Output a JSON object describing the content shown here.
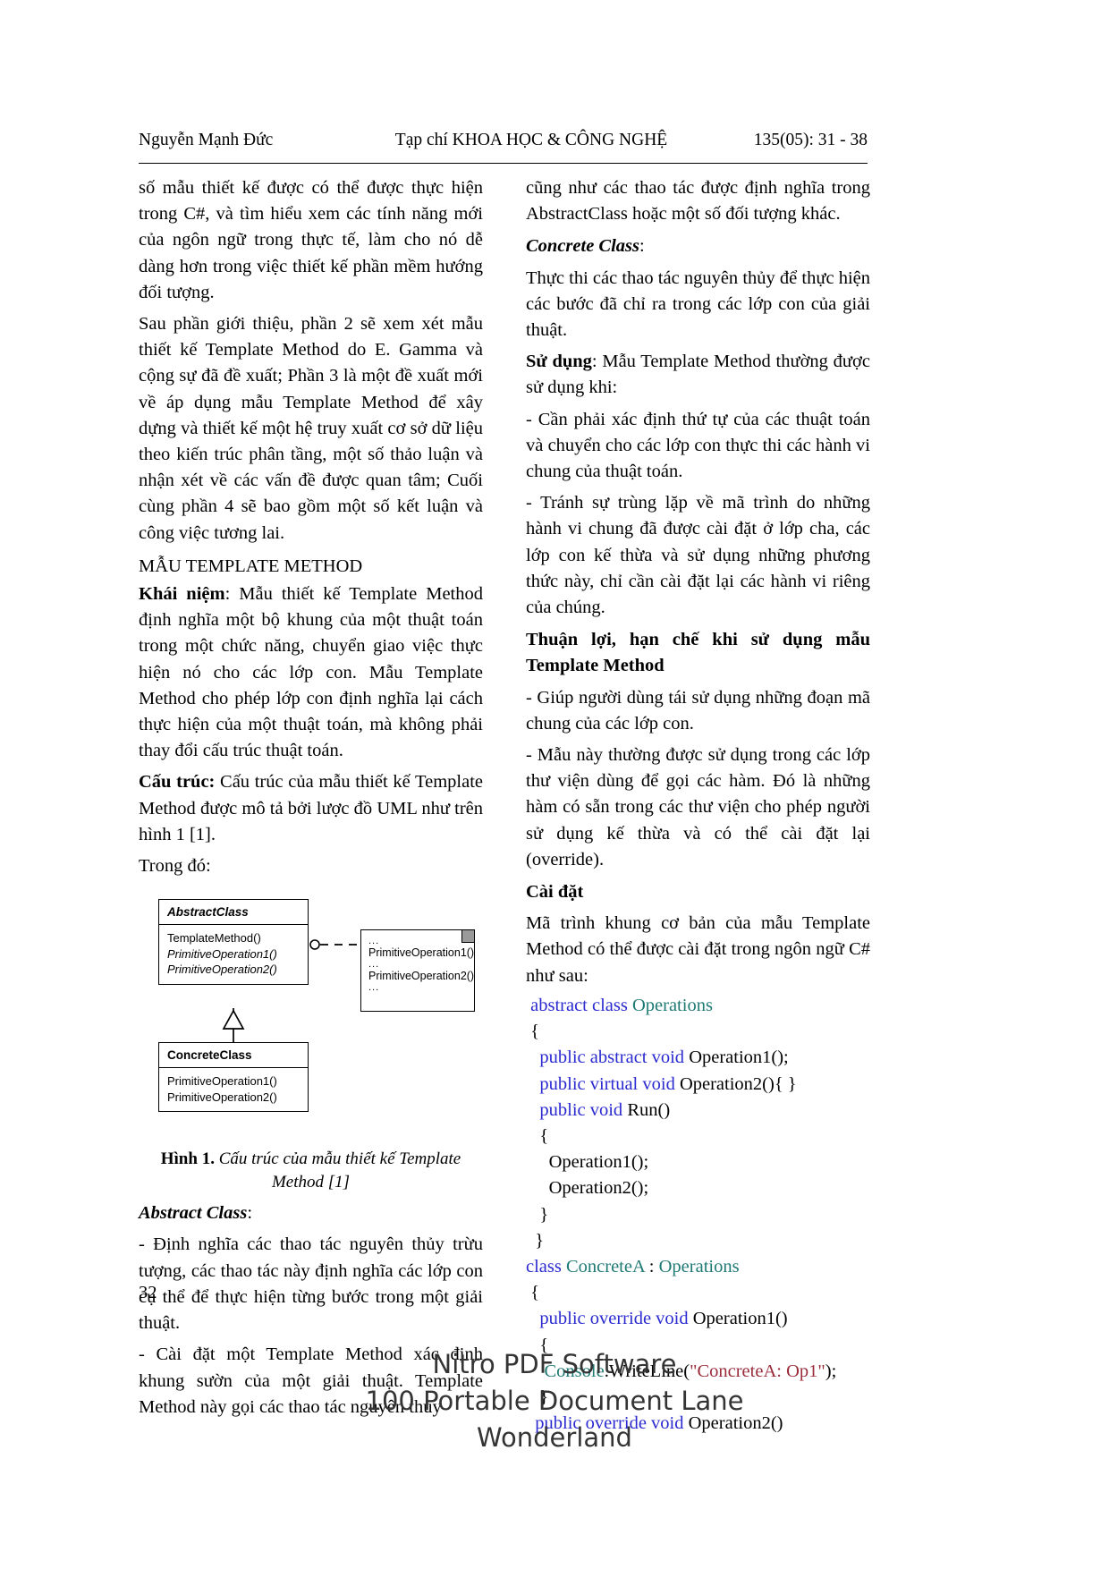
{
  "header": {
    "author": "Nguyễn Mạnh Đức",
    "journal": "Tạp chí KHOA HỌC & CÔNG NGHỆ",
    "citation": "135(05): 31 - 38"
  },
  "left_column": {
    "p1": "số mẫu thiết kế được có thể được thực hiện trong C#, và tìm hiểu xem các tính năng mới của ngôn ngữ trong thực tế, làm cho nó dễ dàng hơn trong việc thiết kế phần mềm hướng đối tượng.",
    "p2": "Sau phần giới thiệu, phần 2 sẽ xem xét mẫu thiết kế Template Method do E. Gamma và cộng sự đã đề xuất; Phần 3 là một đề xuất mới về áp dụng mẫu Template Method để xây dựng và thiết kế một hệ truy xuất cơ sở dữ liệu theo kiến trúc phân tầng, một số thảo luận và nhận xét về các vấn đề được quan tâm; Cuối cùng phần 4 sẽ bao gồm một số kết luận và công việc tương lai.",
    "section_title": "MẪU TEMPLATE METHOD",
    "p3_lead": "Khái niệm",
    "p3_rest": ": Mẫu thiết kế Template Method định nghĩa một bộ khung của một thuật toán trong một chức năng, chuyển giao việc thực hiện nó cho các lớp con. Mẫu Template Method cho phép lớp con định nghĩa lại cách thực hiện của một thuật toán, mà không phải thay đổi cấu trúc thuật toán.",
    "p4_lead": "Cấu trúc:",
    "p4_rest": " Cấu trúc của mẫu thiết kế Template Method được mô tả bởi lược đồ UML như trên hình 1 [1].",
    "p5": "Trong đó:",
    "figure": {
      "abstract_class": {
        "title": "AbstractClass",
        "operations": [
          "TemplateMethod()",
          "PrimitiveOperation1()",
          "PrimitiveOperation2()"
        ]
      },
      "concrete_class": {
        "title": "ConcreteClass",
        "operations": [
          "PrimitiveOperation1()",
          "PrimitiveOperation2()"
        ]
      },
      "note": {
        "line1": "...",
        "line2": "PrimitiveOperation1()",
        "line3": "...",
        "line4": "PrimitiveOperation2()",
        "line5": "..."
      },
      "caption_num": "Hình 1.",
      "caption_text": " Cấu trúc của mẫu thiết kế Template Method [1]"
    },
    "abstract_class_head": "Abstract Class",
    "abstract_class_colon": ":",
    "p6": "- Định nghĩa các thao tác nguyên thủy trừu tượng, các thao tác này định nghĩa các lớp con cụ thể để thực hiện từng bước trong một giải thuật.",
    "p7": "- Cài đặt một Template Method xác định khung sườn của một giải thuật. Template Method này gọi các thao tác nguyên thủy"
  },
  "right_column": {
    "p1": "cũng như các thao tác được định nghĩa trong AbstractClass hoặc một số đối tượng khác.",
    "concrete_class_head": "Concrete Class",
    "concrete_class_colon": ":",
    "p2": "Thực thi các thao tác nguyên thủy để thực hiện các bước đã chỉ ra trong các lớp con của giải thuật.",
    "p3_lead": "Sử dụng",
    "p3_rest": ": Mẫu Template Method thường được sử dụng khi:",
    "p4": "- Cần phải xác định thứ tự của các thuật toán và chuyển cho các lớp con thực thi các hành vi chung của thuật toán.",
    "p5": "- Tránh sự trùng lặp về mã trình do những hành vi chung đã được cài đặt ở lớp cha, các lớp con kế thừa và sử dụng những phương thức này, chỉ cần cài đặt lại các hành vi riêng của chúng.",
    "head2": "Thuận lợi, hạn chế khi sử dụng mẫu Template Method",
    "p6": "- Giúp người dùng tái sử dụng những đoạn mã chung của các lớp con.",
    "p7": "- Mẫu này thường được sử dụng trong các lớp thư viện dùng để gọi các hàm. Đó là những hàm có sẵn trong các thư viện cho phép người sử dụng kế thừa và có thể cài đặt lại (override).",
    "head3": "Cài đặt",
    "p8": "Mã trình khung cơ bản của mẫu Template Method có thể được cài đặt trong ngôn ngữ C# như sau:",
    "code_lines": [
      {
        "indent": 1,
        "tokens": [
          {
            "t": "abstract class ",
            "c": "kw"
          },
          {
            "t": "Operations",
            "c": "ty"
          }
        ]
      },
      {
        "indent": 1,
        "tokens": [
          {
            "t": "{",
            "c": "pl"
          }
        ]
      },
      {
        "indent": 3,
        "tokens": [
          {
            "t": "public abstract void ",
            "c": "kw"
          },
          {
            "t": "Operation1();",
            "c": "pl"
          }
        ]
      },
      {
        "indent": 3,
        "tokens": [
          {
            "t": "public virtual void ",
            "c": "kw"
          },
          {
            "t": "Operation2(){ }",
            "c": "pl"
          }
        ]
      },
      {
        "indent": 3,
        "tokens": [
          {
            "t": "public void ",
            "c": "kw"
          },
          {
            "t": "Run()",
            "c": "pl"
          }
        ]
      },
      {
        "indent": 3,
        "tokens": [
          {
            "t": "{",
            "c": "pl"
          }
        ]
      },
      {
        "indent": 5,
        "tokens": [
          {
            "t": "Operation1();",
            "c": "pl"
          }
        ]
      },
      {
        "indent": 5,
        "tokens": [
          {
            "t": "Operation2();",
            "c": "pl"
          }
        ]
      },
      {
        "indent": 3,
        "tokens": [
          {
            "t": "}",
            "c": "pl"
          }
        ]
      },
      {
        "indent": 2,
        "tokens": [
          {
            "t": "}",
            "c": "pl"
          }
        ]
      },
      {
        "indent": 0,
        "tokens": [
          {
            "t": "class ",
            "c": "kw"
          },
          {
            "t": "ConcreteA",
            "c": "ty"
          },
          {
            "t": " : ",
            "c": "pl"
          },
          {
            "t": "Operations",
            "c": "ty"
          }
        ]
      },
      {
        "indent": 1,
        "tokens": [
          {
            "t": "{",
            "c": "pl"
          }
        ]
      },
      {
        "indent": 3,
        "tokens": [
          {
            "t": "public override void ",
            "c": "kw"
          },
          {
            "t": "Operation1()",
            "c": "pl"
          }
        ]
      },
      {
        "indent": 3,
        "tokens": [
          {
            "t": "{",
            "c": "pl"
          }
        ]
      },
      {
        "indent": 4,
        "tokens": [
          {
            "t": "Console",
            "c": "ty"
          },
          {
            "t": ".WriteLine(",
            "c": "pl"
          },
          {
            "t": "\"ConcreteA: Op1\"",
            "c": "str"
          },
          {
            "t": ");",
            "c": "pl"
          }
        ]
      },
      {
        "indent": 3,
        "tokens": [
          {
            "t": "}",
            "c": "pl"
          }
        ]
      },
      {
        "indent": 2,
        "tokens": [
          {
            "t": "public override void ",
            "c": "kw"
          },
          {
            "t": "Operation2()",
            "c": "pl"
          }
        ]
      }
    ]
  },
  "page_number": "32",
  "watermark": {
    "line1": "Nitro PDF Software",
    "line2": "100 Portable Document Lane",
    "line3": "Wonderland"
  },
  "colors": {
    "keyword": "#2a2ad0",
    "type": "#1f7a74",
    "string": "#9a2b3a",
    "text": "#000000"
  }
}
